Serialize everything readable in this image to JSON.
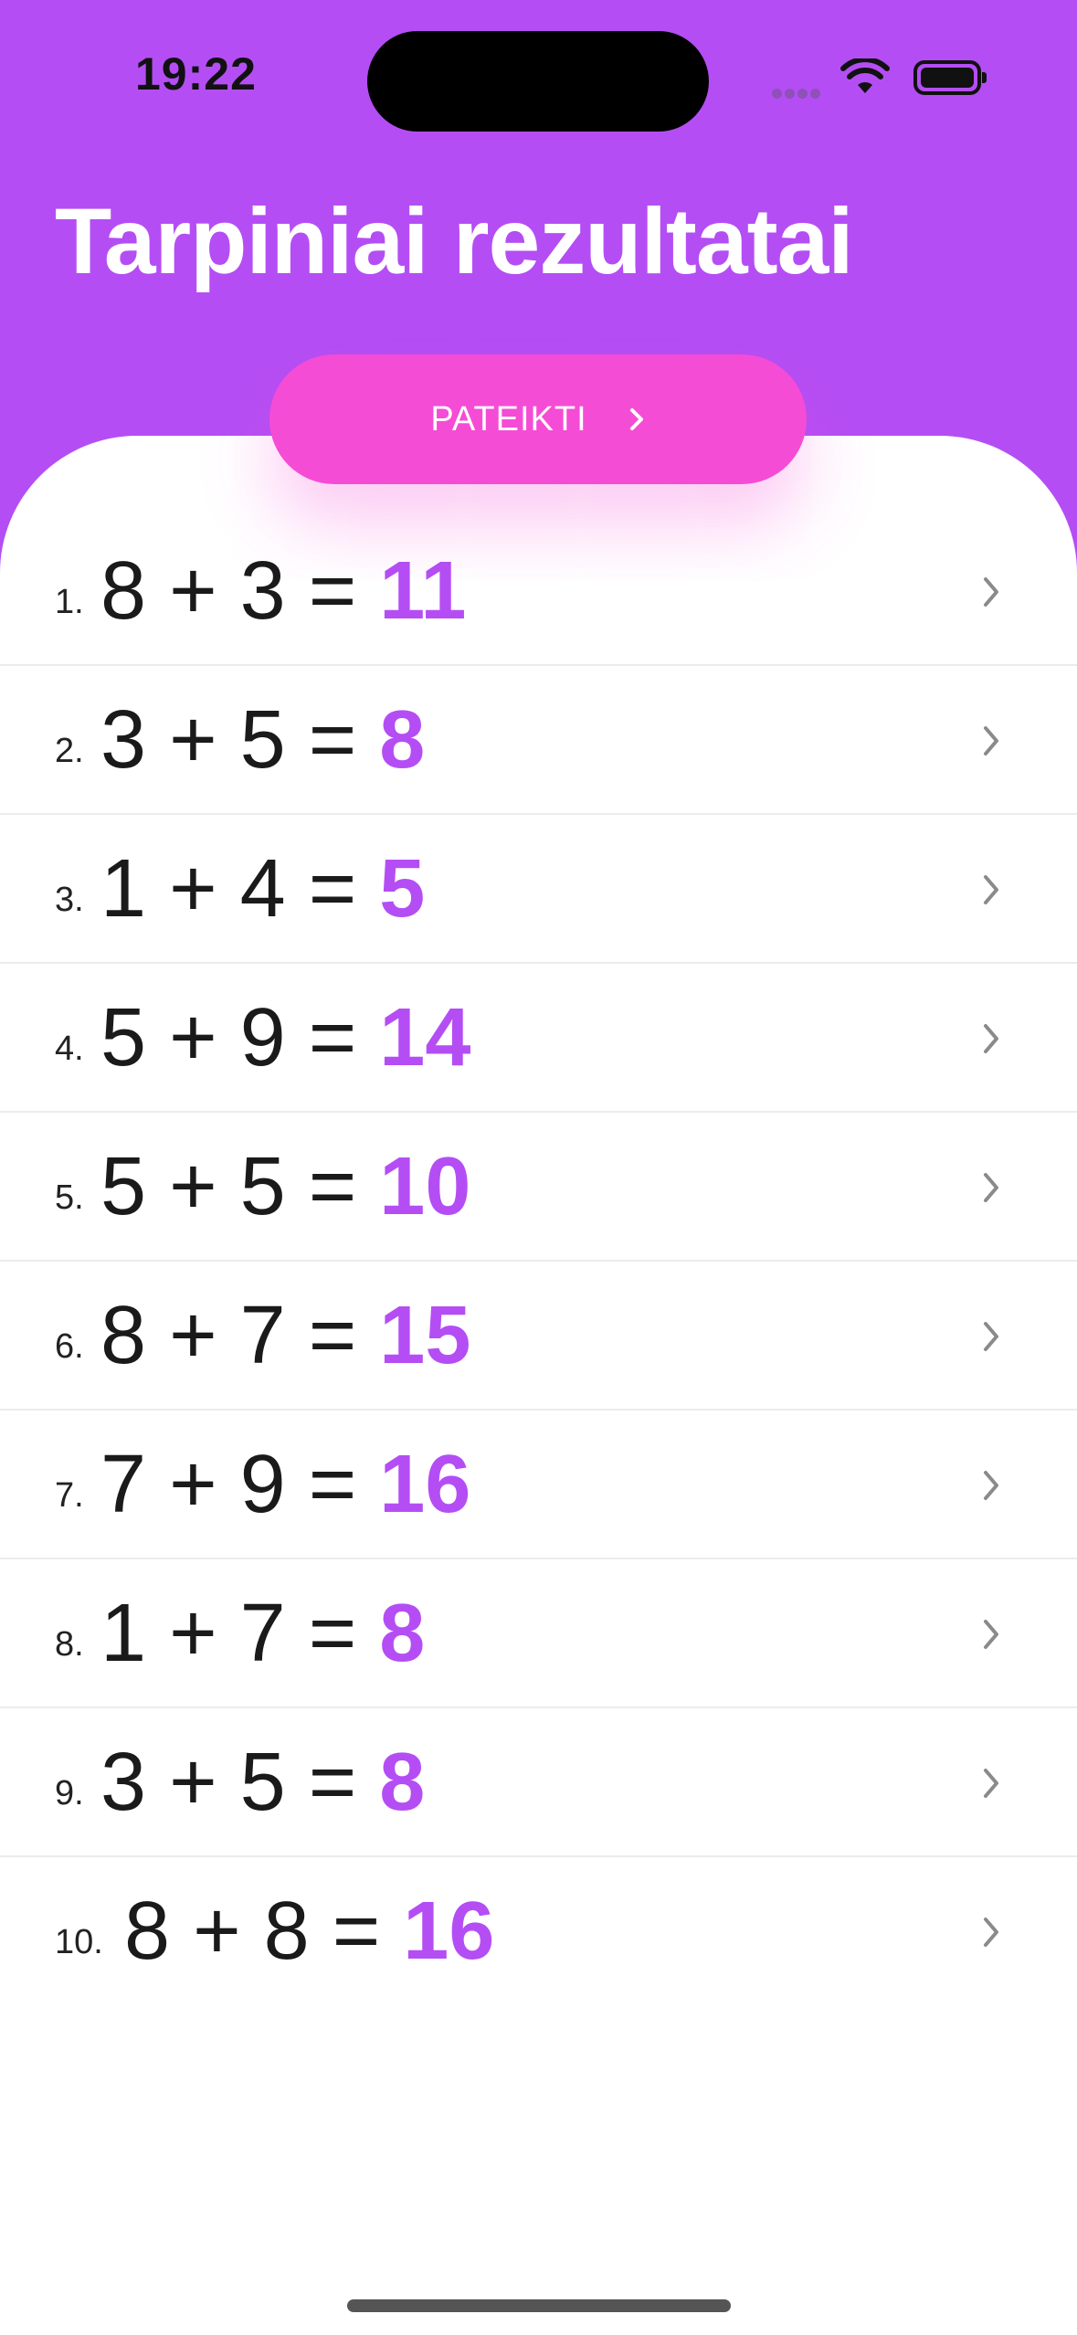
{
  "status_bar": {
    "time": "19:22"
  },
  "header": {
    "title": "Tarpiniai rezultatai"
  },
  "submit_button": {
    "label": "PATEIKTI"
  },
  "colors": {
    "accent": "#b44ef4",
    "button": "#f54cd6"
  },
  "icons": [
    "wifi-icon",
    "battery-icon",
    "signal-icon",
    "chevron-right-icon"
  ],
  "rows": [
    {
      "number": "1.",
      "a": "8",
      "b": "3",
      "answer": "11"
    },
    {
      "number": "2.",
      "a": "3",
      "b": "5",
      "answer": "8"
    },
    {
      "number": "3.",
      "a": "1",
      "b": "4",
      "answer": "5"
    },
    {
      "number": "4.",
      "a": "5",
      "b": "9",
      "answer": "14"
    },
    {
      "number": "5.",
      "a": "5",
      "b": "5",
      "answer": "10"
    },
    {
      "number": "6.",
      "a": "8",
      "b": "7",
      "answer": "15"
    },
    {
      "number": "7.",
      "a": "7",
      "b": "9",
      "answer": "16"
    },
    {
      "number": "8.",
      "a": "1",
      "b": "7",
      "answer": "8"
    },
    {
      "number": "9.",
      "a": "3",
      "b": "5",
      "answer": "8"
    },
    {
      "number": "10.",
      "a": "8",
      "b": "8",
      "answer": "16"
    }
  ]
}
